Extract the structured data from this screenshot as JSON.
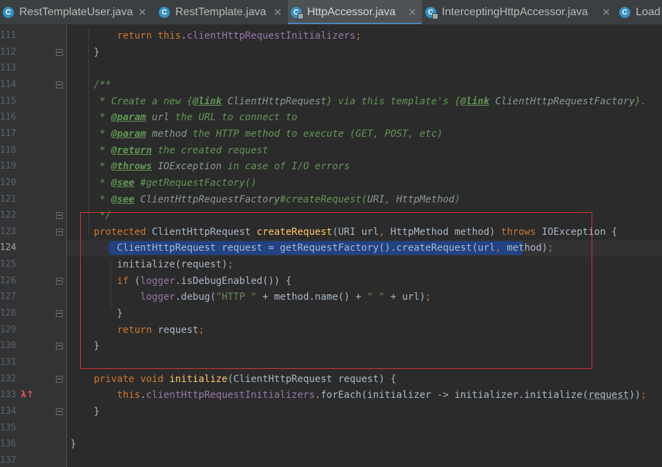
{
  "tabs": [
    {
      "name": "RestTemplateUser.java",
      "icon": "class-icon",
      "active": false
    },
    {
      "name": "RestTemplate.java",
      "icon": "class-icon",
      "active": false
    },
    {
      "name": "HttpAccessor.java",
      "icon": "abstract-class-icon",
      "active": true
    },
    {
      "name": "InterceptingHttpAccessor.java",
      "icon": "abstract-class-icon",
      "active": false
    },
    {
      "name": "Load",
      "icon": "class-icon",
      "active": false
    }
  ],
  "tab_close_glyph": "✕",
  "icon_letter": "C",
  "gutter_marker": "λ↑",
  "lines": [
    {
      "n": "111",
      "html": "        <span class=\"kw\">return this</span>.<span class=\"fld\">clientHttpRequestInitializers</span><span class=\"kw\">;</span>"
    },
    {
      "n": "112",
      "html": "    }"
    },
    {
      "n": "113",
      "html": ""
    },
    {
      "n": "114",
      "html": "    <span class=\"doc\">/**</span>"
    },
    {
      "n": "115",
      "html": "<span class=\"doc\">     * Create a new </span><span class=\"doc\">{</span><span class=\"tag\">@link</span><span class=\"dref\"> ClientHttpRequest</span><span class=\"doc\">} via this template's {</span><span class=\"tag\">@link</span><span class=\"dref\"> ClientHttpRequestFactory</span><span class=\"doc\">}.</span>"
    },
    {
      "n": "116",
      "html": "<span class=\"doc\">     * </span><span class=\"tag\">@param</span><span class=\"doc\"> </span><span class=\"dref\">url</span><span class=\"doc\"> the URL to connect to</span>"
    },
    {
      "n": "117",
      "html": "<span class=\"doc\">     * </span><span class=\"tag\">@param</span><span class=\"doc\"> </span><span class=\"dref\">method</span><span class=\"doc\"> the HTTP method to execute (GET, POST, etc)</span>"
    },
    {
      "n": "118",
      "html": "<span class=\"doc\">     * </span><span class=\"tag\">@return</span><span class=\"doc\"> the created request</span>"
    },
    {
      "n": "119",
      "html": "<span class=\"doc\">     * </span><span class=\"tag\">@throws</span><span class=\"doc\"> </span><span class=\"dref\">IOException</span><span class=\"doc\"> in case of I/O errors</span>"
    },
    {
      "n": "120",
      "html": "<span class=\"doc\">     * </span><span class=\"tag\">@see</span><span class=\"doc\"> #getRequestFactory()</span>"
    },
    {
      "n": "121",
      "html": "<span class=\"doc\">     * </span><span class=\"tag\">@see</span><span class=\"doc\"> </span><span class=\"dref\">ClientHttpRequestFactory</span><span class=\"doc\">#createRequest(</span><span class=\"dref\">URI</span><span class=\"doc\">, </span><span class=\"dref\">HttpMethod</span><span class=\"doc\">)</span>"
    },
    {
      "n": "122",
      "html": "<span class=\"doc\">     */</span>"
    },
    {
      "n": "123",
      "html": "    <span class=\"kw\">protected </span>ClientHttpRequest <span class=\"meth\">createRequest</span>(URI url<span class=\"kw\">, </span>HttpMethod method) <span class=\"kw\">throws </span>IOException {"
    },
    {
      "n": "124",
      "html": "        ClientHttpRequest request = getRequestFactory().createRequest(url<span class=\"kw\">, </span>method)<span class=\"kw\">;</span>"
    },
    {
      "n": "125",
      "html": "        initialize(request)<span class=\"kw\">;</span>"
    },
    {
      "n": "126",
      "html": "        <span class=\"kw\">if </span>(<span class=\"fld\">logger</span>.isDebugEnabled()) {"
    },
    {
      "n": "127",
      "html": "            <span class=\"fld\">logger</span>.debug(<span class=\"str\">\"HTTP \"</span> + method.name() + <span class=\"str\">\" \"</span> + url)<span class=\"kw\">;</span>"
    },
    {
      "n": "128",
      "html": "        }"
    },
    {
      "n": "129",
      "html": "        <span class=\"kw\">return </span>request<span class=\"kw\">;</span>"
    },
    {
      "n": "130",
      "html": "    }"
    },
    {
      "n": "131",
      "html": ""
    },
    {
      "n": "132",
      "html": "    <span class=\"kw\">private void </span><span class=\"meth\">initialize</span>(ClientHttpRequest request) {"
    },
    {
      "n": "133",
      "html": "        <span class=\"kw\">this</span>.<span class=\"fld\">clientHttpRequestInitializers</span>.forEach(initializer -> initializer.initialize(<span class=\"ul\">request</span>))<span class=\"kw\">;</span>"
    },
    {
      "n": "134",
      "html": "    }"
    },
    {
      "n": "135",
      "html": ""
    },
    {
      "n": "136",
      "html": "}"
    },
    {
      "n": "137",
      "html": ""
    }
  ]
}
